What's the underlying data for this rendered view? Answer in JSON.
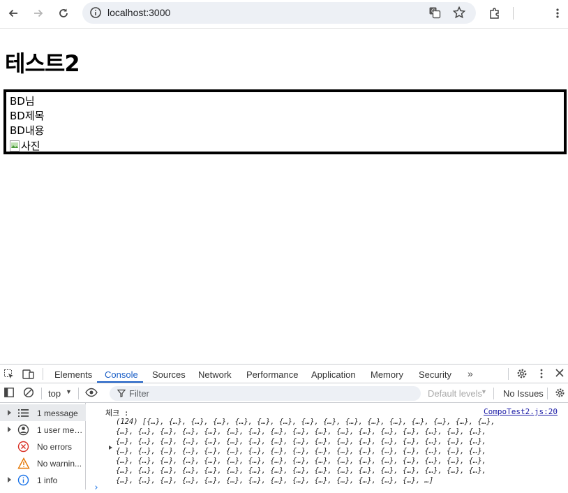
{
  "browser": {
    "url": "localhost:3000",
    "icons": [
      "back-arrow-icon",
      "forward-arrow-icon",
      "reload-icon",
      "info-icon",
      "translate-icon",
      "star-icon",
      "extensions-icon",
      "kebab-menu-icon"
    ]
  },
  "page": {
    "title": "테스트2",
    "card": {
      "name": "BD님",
      "subject": "BD제목",
      "content": "BD내용",
      "image_alt": "사진"
    }
  },
  "devtools": {
    "tabs": [
      "Elements",
      "Console",
      "Sources",
      "Network",
      "Performance",
      "Application",
      "Memory",
      "Security"
    ],
    "active_tab": "Console",
    "context": "top",
    "filter_placeholder": "Filter",
    "levels": "Default levels",
    "issues": "No Issues",
    "sidebar": [
      {
        "label": "1 message",
        "icon": "list-icon"
      },
      {
        "label": "1 user mes...",
        "icon": "user-icon"
      },
      {
        "label": "No errors",
        "icon": "error-icon"
      },
      {
        "label": "No warnin...",
        "icon": "warning-icon"
      },
      {
        "label": "1 info",
        "icon": "info-icon"
      }
    ],
    "log": {
      "label": "체크 :",
      "source": "CompoTest2.js:20",
      "lines": [
        "(124) [{…}, {…}, {…}, {…}, {…}, {…}, {…}, {…}, {…}, {…}, {…}, {…}, {…}, {…}, {…}, {…},",
        "{…}, {…}, {…}, {…}, {…}, {…}, {…}, {…}, {…}, {…}, {…}, {…}, {…}, {…}, {…}, {…}, {…},",
        "{…}, {…}, {…}, {…}, {…}, {…}, {…}, {…}, {…}, {…}, {…}, {…}, {…}, {…}, {…}, {…}, {…},",
        "{…}, {…}, {…}, {…}, {…}, {…}, {…}, {…}, {…}, {…}, {…}, {…}, {…}, {…}, {…}, {…}, {…},",
        "{…}, {…}, {…}, {…}, {…}, {…}, {…}, {…}, {…}, {…}, {…}, {…}, {…}, {…}, {…}, {…}, {…},",
        "{…}, {…}, {…}, {…}, {…}, {…}, {…}, {…}, {…}, {…}, {…}, {…}, {…}, {…}, {…}, {…}, {…},",
        "{…}, {…}, {…}, {…}, {…}, {…}, {…}, {…}, {…}, {…}, {…}, {…}, {…}, {…}, …]"
      ]
    },
    "colors": {
      "accent": "#1a5ec6",
      "panel_border": "#cbcdd1"
    }
  }
}
